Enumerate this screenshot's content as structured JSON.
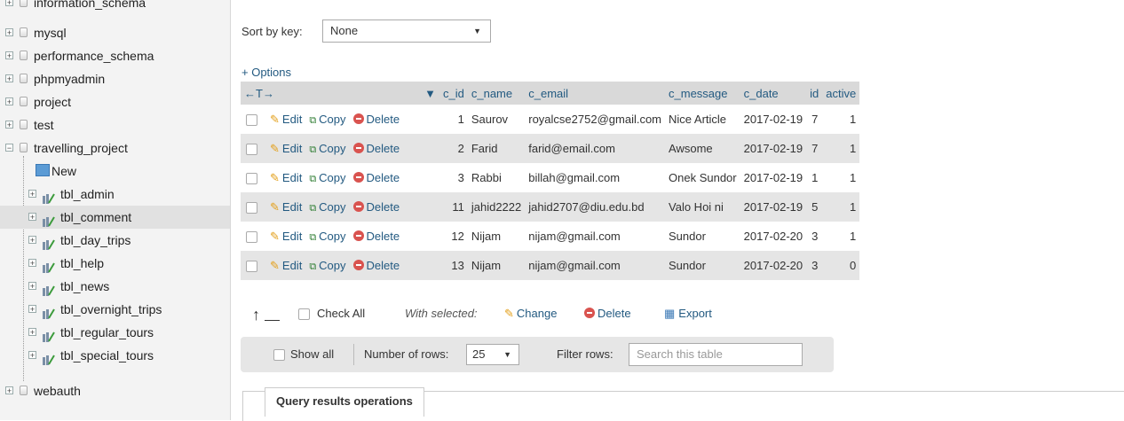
{
  "sidebar": {
    "items": [
      {
        "label": "information_schema",
        "kind": "db"
      },
      {
        "label": "mysql",
        "kind": "db"
      },
      {
        "label": "performance_schema",
        "kind": "db"
      },
      {
        "label": "phpmyadmin",
        "kind": "db"
      },
      {
        "label": "project",
        "kind": "db"
      },
      {
        "label": "test",
        "kind": "db"
      },
      {
        "label": "travelling_project",
        "kind": "db-open"
      },
      {
        "label": "New",
        "kind": "new"
      },
      {
        "label": "tbl_admin",
        "kind": "table"
      },
      {
        "label": "tbl_comment",
        "kind": "table",
        "selected": true
      },
      {
        "label": "tbl_day_trips",
        "kind": "table"
      },
      {
        "label": "tbl_help",
        "kind": "table"
      },
      {
        "label": "tbl_news",
        "kind": "table"
      },
      {
        "label": "tbl_overnight_trips",
        "kind": "table"
      },
      {
        "label": "tbl_regular_tours",
        "kind": "table"
      },
      {
        "label": "tbl_special_tours",
        "kind": "table"
      },
      {
        "label": "webauth",
        "kind": "db"
      }
    ]
  },
  "sort": {
    "label": "Sort by key:",
    "value": "None"
  },
  "options_link": "+ Options",
  "table": {
    "arrows": "←T→",
    "headers": [
      "c_id",
      "c_name",
      "c_email",
      "c_message",
      "c_date",
      "id",
      "active"
    ],
    "actions": {
      "edit": "Edit",
      "copy": "Copy",
      "delete": "Delete"
    },
    "rows": [
      {
        "c_id": "1",
        "c_name": "Saurov",
        "c_email": "royalcse2752@gmail.com",
        "c_message": "Nice Article",
        "c_date": "2017-02-19",
        "id": "7",
        "active": "1"
      },
      {
        "c_id": "2",
        "c_name": "Farid",
        "c_email": "farid@email.com",
        "c_message": "Awsome",
        "c_date": "2017-02-19",
        "id": "7",
        "active": "1"
      },
      {
        "c_id": "3",
        "c_name": "Rabbi",
        "c_email": "billah@gmail.com",
        "c_message": "Onek Sundor",
        "c_date": "2017-02-19",
        "id": "1",
        "active": "1"
      },
      {
        "c_id": "11",
        "c_name": "jahid2222",
        "c_email": "jahid2707@diu.edu.bd",
        "c_message": "Valo Hoi ni",
        "c_date": "2017-02-19",
        "id": "5",
        "active": "1"
      },
      {
        "c_id": "12",
        "c_name": "Nijam",
        "c_email": "nijam@gmail.com",
        "c_message": "Sundor",
        "c_date": "2017-02-20",
        "id": "3",
        "active": "1"
      },
      {
        "c_id": "13",
        "c_name": "Nijam",
        "c_email": "nijam@gmail.com",
        "c_message": "Sundor",
        "c_date": "2017-02-20",
        "id": "3",
        "active": "0"
      }
    ]
  },
  "bulk": {
    "check_all": "Check All",
    "with_selected": "With selected:",
    "change": "Change",
    "delete": "Delete",
    "export": "Export"
  },
  "nav": {
    "show_all": "Show all",
    "rows_label": "Number of rows:",
    "rows_value": "25",
    "filter_label": "Filter rows:",
    "filter_placeholder": "Search this table"
  },
  "query_ops": "Query results operations"
}
